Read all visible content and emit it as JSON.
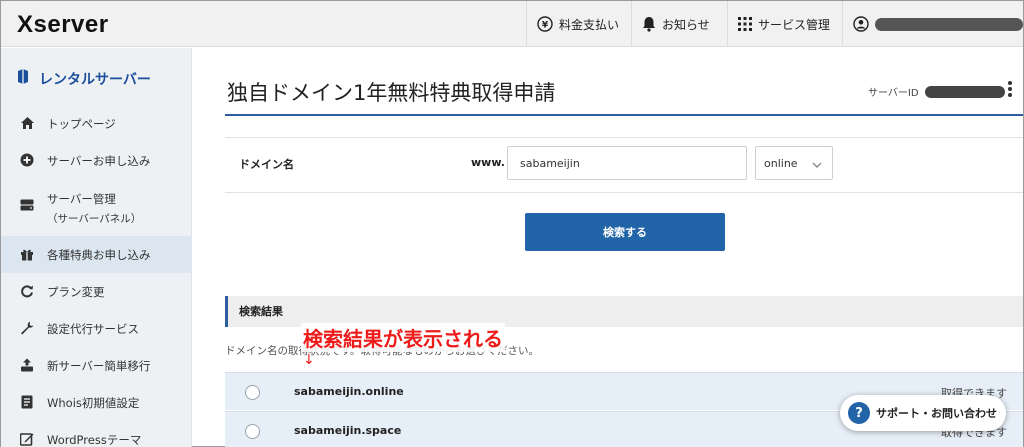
{
  "header": {
    "logo": "Xserver",
    "nav": [
      {
        "label": "料金支払い",
        "icon": "yen-coin-icon"
      },
      {
        "label": "お知らせ",
        "icon": "bell-icon"
      },
      {
        "label": "サービス管理",
        "icon": "grid-icon"
      },
      {
        "label": "",
        "icon": "user-icon"
      }
    ]
  },
  "sidebar": {
    "title": "レンタルサーバー",
    "items": [
      {
        "label": "トップページ",
        "icon": "home-icon"
      },
      {
        "label": "サーバーお申し込み",
        "icon": "plus-circle-icon"
      },
      {
        "label": "サーバー管理",
        "sub": "（サーバーパネル）",
        "icon": "server-icon"
      },
      {
        "label": "各種特典お申し込み",
        "icon": "gift-icon",
        "active": true
      },
      {
        "label": "プラン変更",
        "icon": "refresh-icon"
      },
      {
        "label": "設定代行サービス",
        "icon": "wrench-icon"
      },
      {
        "label": "新サーバー簡単移行",
        "icon": "migration-icon"
      },
      {
        "label": "Whois初期値設定",
        "icon": "document-icon"
      },
      {
        "label": "WordPressテーマ",
        "icon": "theme-icon"
      }
    ]
  },
  "main": {
    "title": "独自ドメイン1年無料特典取得申請",
    "server_id_label": "サーバーID",
    "form": {
      "label": "ドメイン名",
      "prefix": "www.",
      "domain_value": "sabameijin",
      "tld_value": "online"
    },
    "search_button": "検索する",
    "results": {
      "header": "検索結果",
      "instruction": "ドメイン名の取得状況です。取得可能なものからお選びください。",
      "annotation": "検索結果が表示される",
      "annotation_arrow": "↓",
      "rows": [
        {
          "domain": "sabameijin.online",
          "status": "取得できます"
        },
        {
          "domain": "sabameijin.space",
          "status": "取得できます"
        }
      ]
    },
    "support_button": "サポート・お問い合わせ",
    "support_icon_glyph": "?"
  },
  "colors": {
    "accent": "#2264a8",
    "annotation": "#ee1b1b",
    "sidebar_bg": "#eef1f4",
    "result_row_bg": "#e6eef7"
  }
}
